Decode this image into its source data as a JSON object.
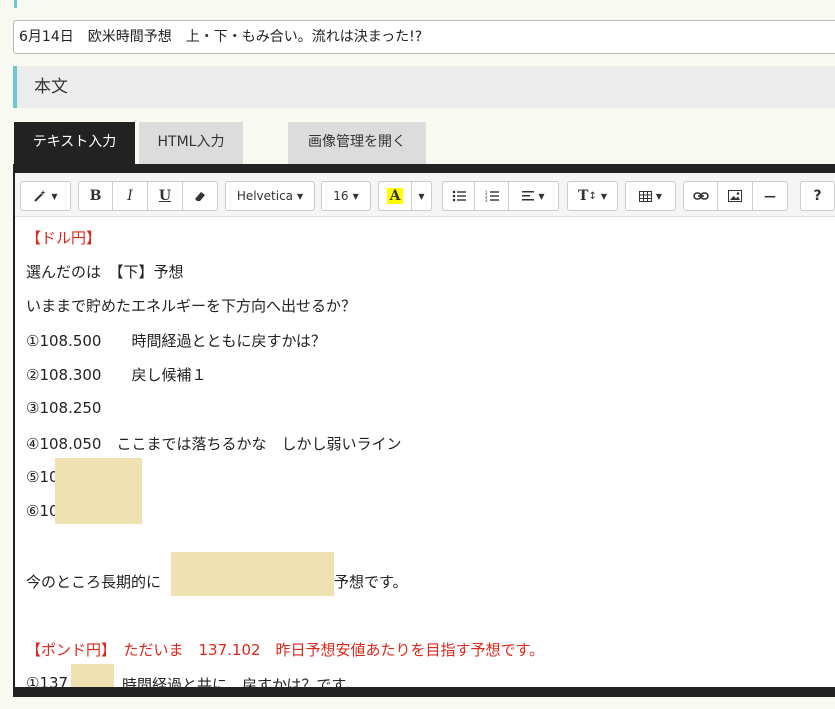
{
  "post": {
    "title": "6月14日　欧米時間予想　上・下・もみ合い。流れは決まった!?",
    "section_label": "本文"
  },
  "tabs": {
    "text_input": "テキスト入力",
    "html_input": "HTML入力",
    "image_manager": "画像管理を開く"
  },
  "toolbar": {
    "font_family": "Helvetica",
    "font_size": "16",
    "bold": "B",
    "italic": "I",
    "underline": "U",
    "highlight": "A",
    "text_height": "T",
    "help": "?",
    "hr": "—"
  },
  "content": {
    "line1": "【ドル円】",
    "line2": "選んだのは　【下】予想",
    "line3": "いままで貯めたエネルギーを下方向へ出せるか？",
    "line4": "①108.500　　時間経過とともに戻すかは？",
    "line5": "②108.300　　戻し候補１",
    "line6": "③108.250",
    "line7": "④108.050　ここまでは落ちるかな　しかし弱いライン",
    "line8": "⑤10",
    "line9": "⑥10",
    "line10a": "今のところ長期的に",
    "line10b": "予想です。",
    "line11": "【ポンド円】　ただいま　137.102　昨日予想安値あたりを目指す予想です。",
    "line12a": "①137",
    "line12b": "時間経過と共に　戻すかは？です。"
  }
}
